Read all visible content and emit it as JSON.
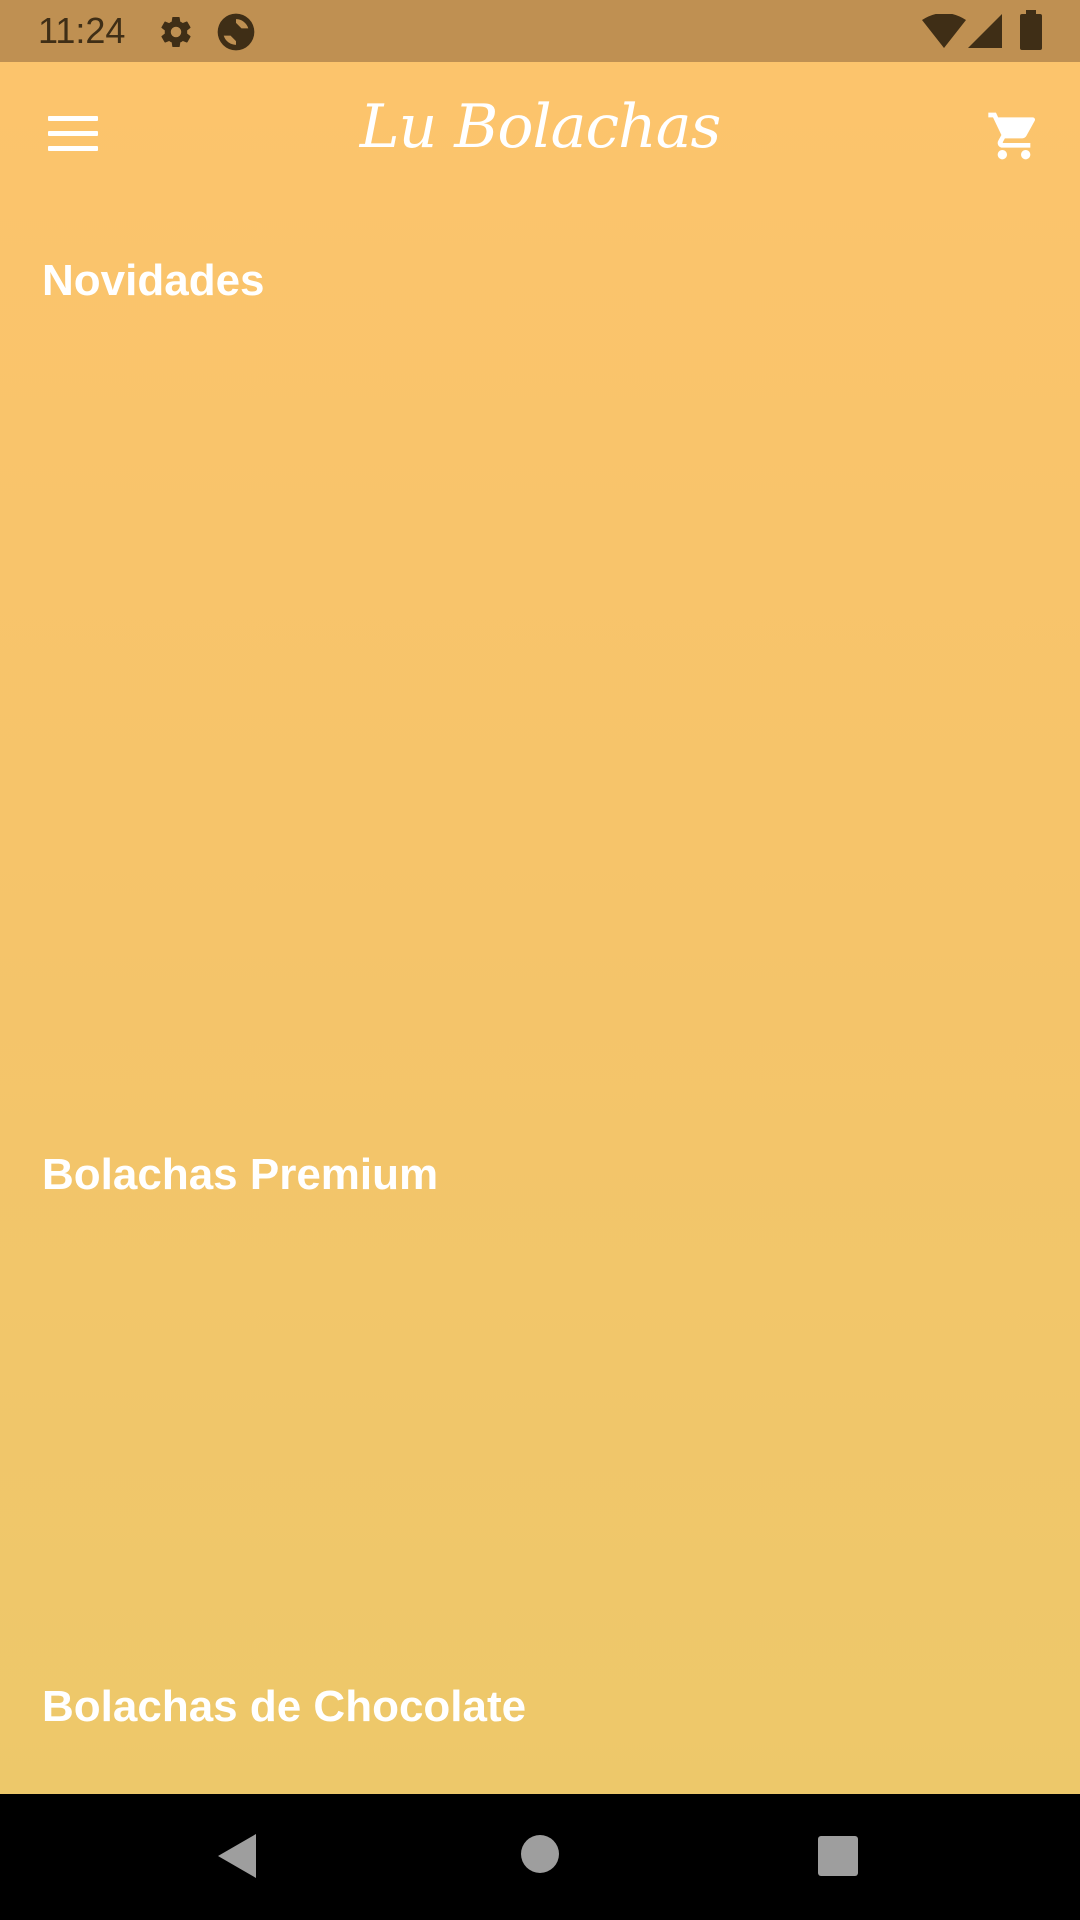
{
  "status_bar": {
    "time": "11:24",
    "icons": [
      "gear-icon",
      "sync-icon",
      "wifi-icon",
      "signal-icon",
      "battery-icon"
    ]
  },
  "toolbar": {
    "title": "Lu Bolachas",
    "menu_icon": "hamburger-menu-icon",
    "cart_icon": "shopping-cart-icon"
  },
  "sections": [
    {
      "title": "Novidades"
    },
    {
      "title": "Bolachas Premium"
    },
    {
      "title": "Bolachas de Chocolate"
    }
  ],
  "nav_bar": {
    "buttons": [
      "back-icon",
      "home-icon",
      "recents-icon"
    ]
  },
  "colors": {
    "status_bar": "#bf9052",
    "background_top": "#fcc46c",
    "background_bottom": "#edc86a",
    "text": "#ffffff"
  }
}
